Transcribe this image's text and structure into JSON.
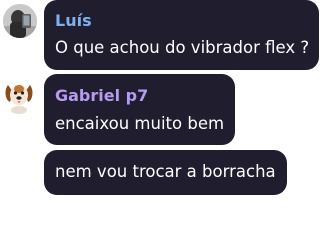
{
  "messages": [
    {
      "author": "Luís",
      "author_color": "#7fb0ef",
      "avatar_icon": "user-photo-avatar",
      "text": "O que achou do vibrador flex ?"
    },
    {
      "author": "Gabriel p7",
      "author_color": "#b79af2",
      "avatar_icon": "dog-avatar",
      "text": "encaixou muito bem"
    },
    {
      "text": "nem vou trocar a borracha"
    }
  ],
  "colors": {
    "bubble": "#1f1d2e",
    "message_text": "#ffffff",
    "background": "#ffffff"
  }
}
